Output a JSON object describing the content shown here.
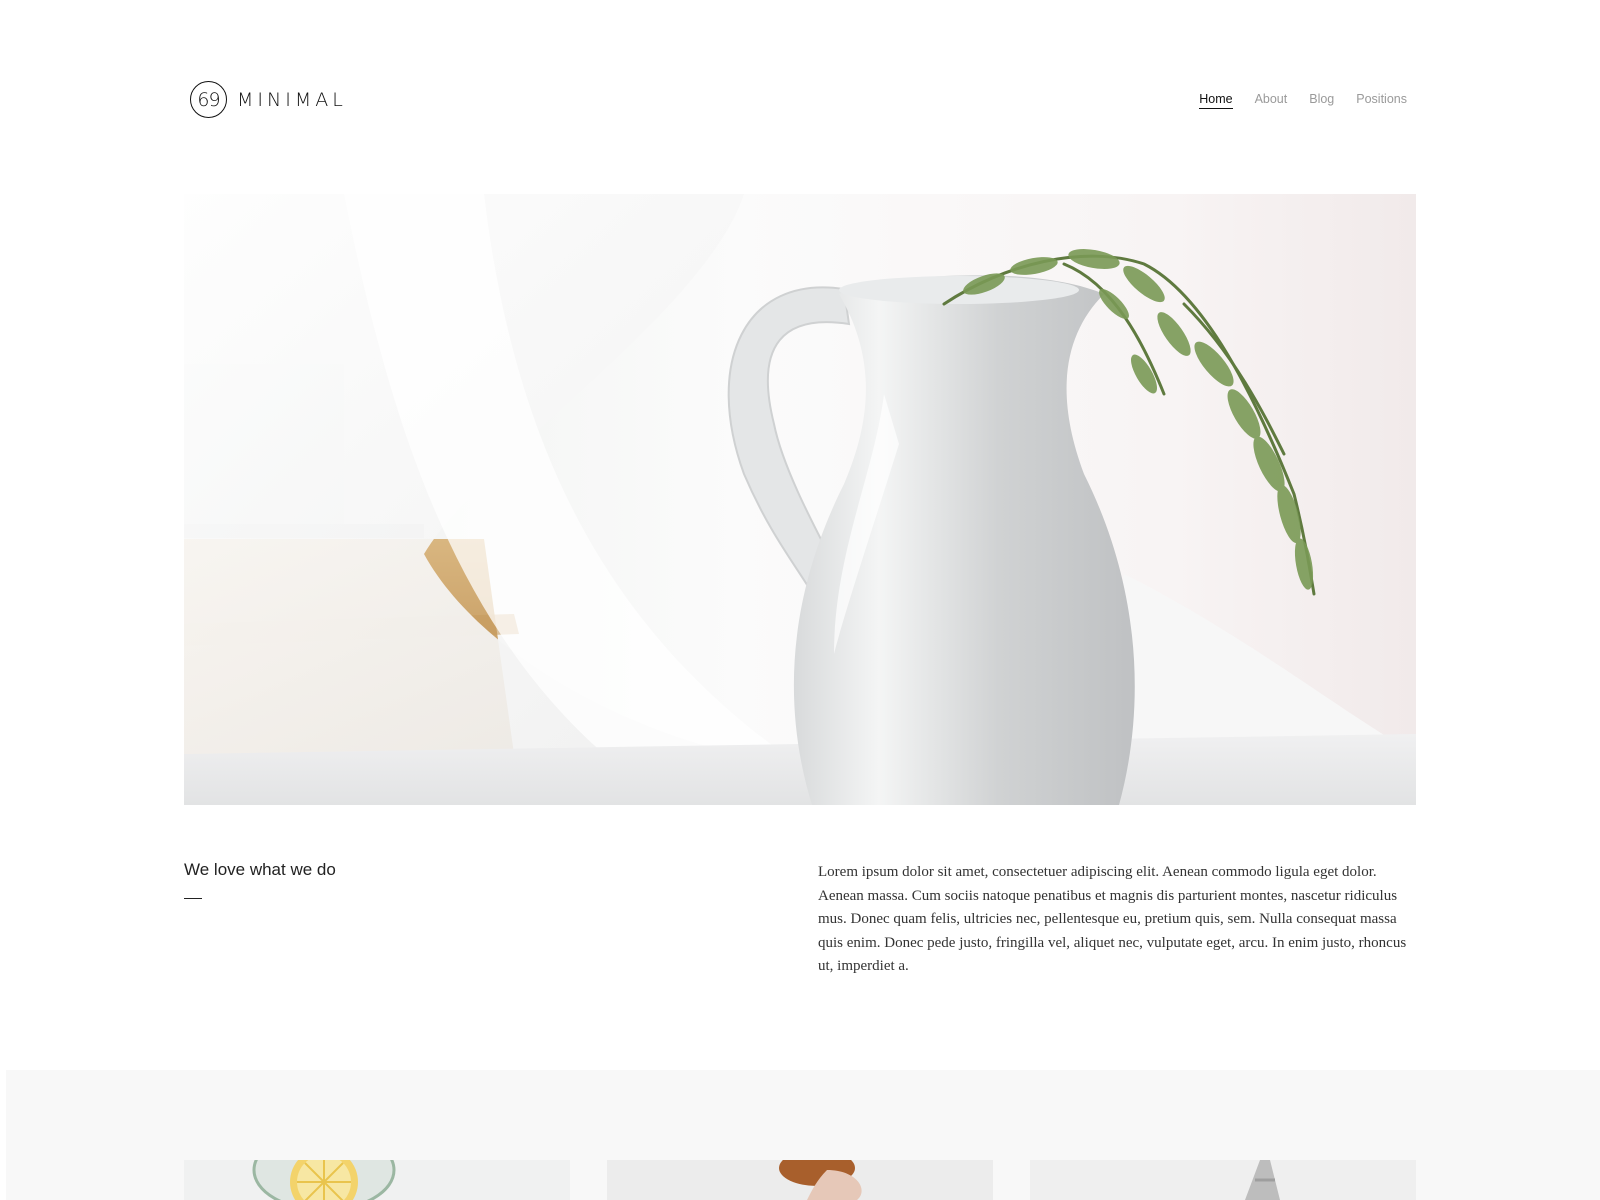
{
  "brand": {
    "mark": "69",
    "name": "MINIMAL"
  },
  "nav": {
    "items": [
      {
        "label": "Home",
        "active": true
      },
      {
        "label": "About",
        "active": false
      },
      {
        "label": "Blog",
        "active": false
      },
      {
        "label": "Positions",
        "active": false
      }
    ]
  },
  "intro": {
    "title": "We love what we do",
    "body": "Lorem ipsum dolor sit amet, consectetuer adipiscing elit. Aenean commodo ligula eget dolor. Aenean massa. Cum sociis natoque penatibus et magnis dis parturient montes, nascetur ridiculus mus. Donec quam felis, ultricies nec, pellentesque eu, pretium quis, sem. Nulla consequat massa quis enim. Donec pede justo, fringilla vel, aliquet nec, vulputate eget, arcu. In enim justo, rhoncus ut, imperdiet a."
  },
  "colors": {
    "text": "#222222",
    "nav_inactive": "#9a9a9a",
    "band_background": "#f8f8f8"
  }
}
